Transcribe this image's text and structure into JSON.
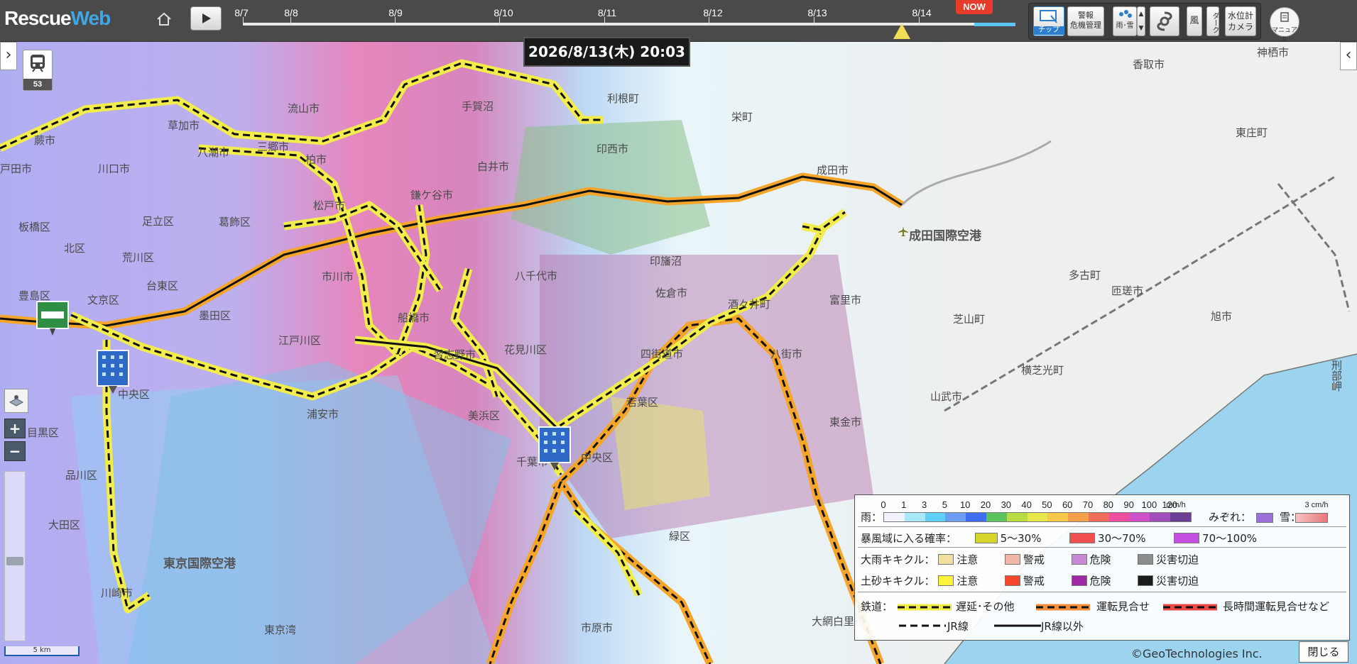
{
  "app": {
    "logo_part1": "Rescue",
    "logo_part2": "Web"
  },
  "timeline": {
    "dates": [
      "8/7",
      "8/8",
      "8/9",
      "8/10",
      "8/11",
      "8/12",
      "8/13",
      "8/14"
    ],
    "now_label": "NOW",
    "current": "2026/8/13(木) 20:03"
  },
  "toolbar": {
    "chip_label": "チップ",
    "warning_top": "警報",
    "warning_bottom": "危機管理",
    "rain_label": "雨･雪",
    "wind_label": "風",
    "dark_label": "ダーク",
    "water_top": "水位計",
    "water_bottom": "カメラ",
    "manual_label": "マニュアル"
  },
  "side": {
    "train_count": "53",
    "zoom_in": "+",
    "zoom_out": "−",
    "scale": "5 km"
  },
  "places": [
    {
      "name": "神栖市",
      "big": false
    },
    {
      "name": "香取市",
      "big": false
    },
    {
      "name": "東庄町",
      "big": false
    },
    {
      "name": "利根町",
      "big": false
    },
    {
      "name": "栄町",
      "big": false
    },
    {
      "name": "成田市",
      "big": false
    },
    {
      "name": "成田国際空港",
      "big": true
    },
    {
      "name": "多古町",
      "big": false
    },
    {
      "name": "匝瑳市",
      "big": false
    },
    {
      "name": "旭市",
      "big": false
    },
    {
      "name": "芝山町",
      "big": false
    },
    {
      "name": "富里市",
      "big": false
    },
    {
      "name": "印西市",
      "big": false
    },
    {
      "name": "白井市",
      "big": false
    },
    {
      "name": "印旛沼",
      "big": false
    },
    {
      "name": "鎌ケ谷市",
      "big": false
    },
    {
      "name": "八千代市",
      "big": false
    },
    {
      "name": "佐倉市",
      "big": false
    },
    {
      "name": "酒々井町",
      "big": false
    },
    {
      "name": "四街道市",
      "big": false
    },
    {
      "name": "八街市",
      "big": false
    },
    {
      "name": "横芝光町",
      "big": false
    },
    {
      "name": "山武市",
      "big": false
    },
    {
      "name": "若葉区",
      "big": false
    },
    {
      "name": "花見川区",
      "big": false
    },
    {
      "name": "美浜区",
      "big": false
    },
    {
      "name": "千葉市",
      "big": false
    },
    {
      "name": "中央区",
      "big": false
    },
    {
      "name": "緑区",
      "big": false
    },
    {
      "name": "市原市",
      "big": false
    },
    {
      "name": "大網白里市",
      "big": false
    },
    {
      "name": "東金市",
      "big": false
    },
    {
      "name": "流山市",
      "big": false
    },
    {
      "name": "手賀沼",
      "big": false
    },
    {
      "name": "柏市",
      "big": false
    },
    {
      "name": "草加市",
      "big": false
    },
    {
      "name": "八潮市",
      "big": false
    },
    {
      "name": "三郷市",
      "big": false
    },
    {
      "name": "松戸市",
      "big": false
    },
    {
      "name": "市川市",
      "big": false
    },
    {
      "name": "船橋市",
      "big": false
    },
    {
      "name": "習志野市",
      "big": false
    },
    {
      "name": "浦安市",
      "big": false
    },
    {
      "name": "江戸川区",
      "big": false
    },
    {
      "name": "墨田区",
      "big": false
    },
    {
      "name": "台東区",
      "big": false
    },
    {
      "name": "文京区",
      "big": false
    },
    {
      "name": "豊島区",
      "big": false
    },
    {
      "name": "板橋区",
      "big": false
    },
    {
      "name": "北区",
      "big": false
    },
    {
      "name": "足立区",
      "big": false
    },
    {
      "name": "荒川区",
      "big": false
    },
    {
      "name": "葛飾区",
      "big": false
    },
    {
      "name": "中央区",
      "big": false
    },
    {
      "name": "目黒区",
      "big": false
    },
    {
      "name": "品川区",
      "big": false
    },
    {
      "name": "大田区",
      "big": false
    },
    {
      "name": "東京国際空港",
      "big": true
    },
    {
      "name": "川崎市",
      "big": false
    },
    {
      "name": "川口市",
      "big": false
    },
    {
      "name": "戸田市",
      "big": false
    },
    {
      "name": "蕨市",
      "big": false
    },
    {
      "name": "東京湾",
      "big": false
    },
    {
      "name": "刑部岬",
      "big": false
    }
  ],
  "legend": {
    "rain_label": "雨：",
    "rain_numbers": [
      "0",
      "1",
      "3",
      "5",
      "10",
      "20",
      "30",
      "40",
      "50",
      "60",
      "70",
      "80",
      "90",
      "100",
      "120"
    ],
    "rain_unit": "mm/h",
    "rain_colors": [
      "#f2f2ff",
      "#a8e8f9",
      "#5fd0f5",
      "#6e9cf0",
      "#3f6cf0",
      "#5ac45c",
      "#b7dd43",
      "#e7e84b",
      "#f7c84a",
      "#f4a04a",
      "#ef6d5b",
      "#ef4fa0",
      "#d052c8",
      "#a14fbd",
      "#6c3f95"
    ],
    "sleet_label": "みぞれ：",
    "snow_label": "雪：",
    "snow_unit": "3 cm/h",
    "storm_label": "暴風域に入る確率：",
    "storm": [
      {
        "label": "5〜30%",
        "color": "#d5d52c"
      },
      {
        "label": "30〜70%",
        "color": "#f25050"
      },
      {
        "label": "70〜100%",
        "color": "#c64ee0"
      }
    ],
    "heavy_label": "大雨キキクル：",
    "heavy": [
      {
        "label": "注意",
        "color": "#f0e0a0"
      },
      {
        "label": "警戒",
        "color": "#f3b7a7"
      },
      {
        "label": "危険",
        "color": "#c88ad4"
      },
      {
        "label": "災害切迫",
        "color": "#8c8c8c"
      }
    ],
    "land_label": "土砂キキクル：",
    "land": [
      {
        "label": "注意",
        "color": "#fff23a"
      },
      {
        "label": "警戒",
        "color": "#f5452a"
      },
      {
        "label": "危険",
        "color": "#a026a8"
      },
      {
        "label": "災害切迫",
        "color": "#1c1c1c"
      }
    ],
    "rail_label": "鉄道：",
    "rail": [
      {
        "label": "遅延･その他",
        "color": "#f2ed4a"
      },
      {
        "label": "運転見合せ",
        "color": "#f2913a"
      },
      {
        "label": "長時間運転見合せなど",
        "color": "#e84a4a"
      }
    ],
    "jr_label": "JR線",
    "nonjr_label": "JR線以外"
  },
  "footer": {
    "copyright": "©GeoTechnologies Inc.",
    "close": "閉じる"
  }
}
